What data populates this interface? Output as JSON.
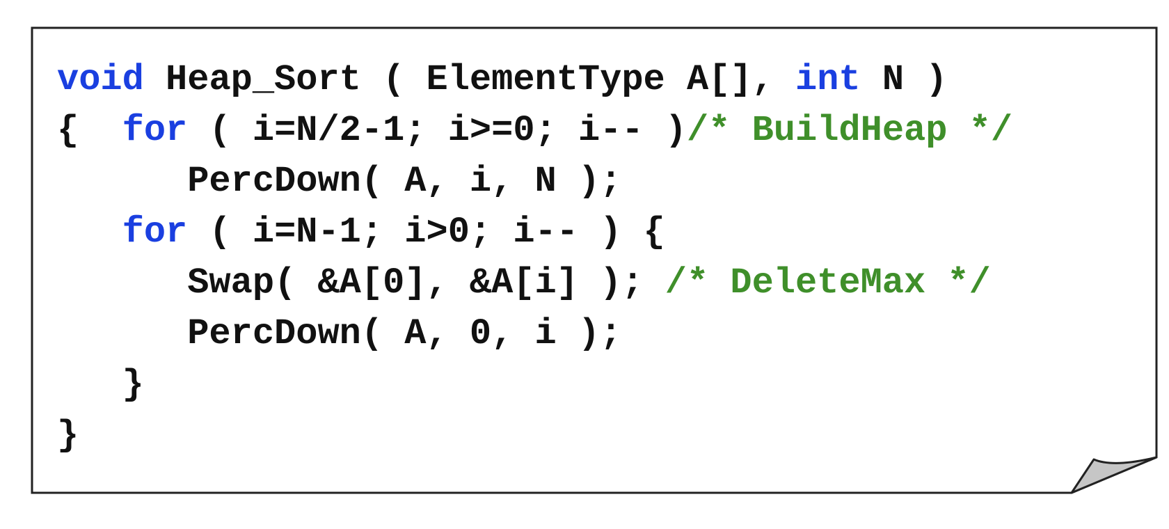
{
  "colors": {
    "keyword": "#1a3fe0",
    "comment": "#3f8f2a",
    "text": "#111111",
    "border": "#222222",
    "fold": "#c6c6c6"
  },
  "code": {
    "lines": [
      [
        {
          "t": "kw",
          "v": "void"
        },
        {
          "t": "tx",
          "v": " Heap_Sort ( ElementType A[], "
        },
        {
          "t": "kw",
          "v": "int"
        },
        {
          "t": "tx",
          "v": " N )"
        }
      ],
      [
        {
          "t": "tx",
          "v": "{  "
        },
        {
          "t": "kw",
          "v": "for"
        },
        {
          "t": "tx",
          "v": " ( i=N/2-1; i>=0; i-- )"
        },
        {
          "t": "cm",
          "v": "/* BuildHeap */"
        }
      ],
      [
        {
          "t": "tx",
          "v": "      PercDown( A, i, N );"
        }
      ],
      [
        {
          "t": "tx",
          "v": "   "
        },
        {
          "t": "kw",
          "v": "for"
        },
        {
          "t": "tx",
          "v": " ( i=N-1; i>0; i-- ) {"
        }
      ],
      [
        {
          "t": "tx",
          "v": "      Swap( &A[0], &A[i] ); "
        },
        {
          "t": "cm",
          "v": "/* DeleteMax */"
        }
      ],
      [
        {
          "t": "tx",
          "v": "      PercDown( A, 0, i );"
        }
      ],
      [
        {
          "t": "tx",
          "v": "   }"
        }
      ],
      [
        {
          "t": "tx",
          "v": "}"
        }
      ]
    ]
  }
}
